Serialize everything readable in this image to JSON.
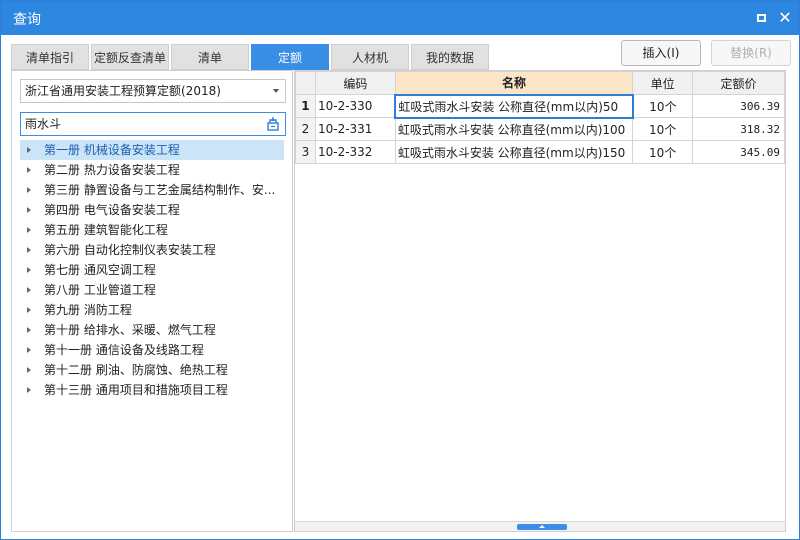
{
  "window": {
    "title": "查询"
  },
  "tabs": [
    {
      "label": "清单指引"
    },
    {
      "label": "定额反查清单"
    },
    {
      "label": "清单"
    },
    {
      "label": "定额"
    },
    {
      "label": "人材机"
    },
    {
      "label": "我的数据"
    }
  ],
  "toolbar": {
    "insert_label": "插入(I)",
    "replace_label": "替换(R)"
  },
  "left": {
    "selected_norm": "浙江省通用安装工程预算定额(2018)",
    "search_value": "雨水斗",
    "tree": [
      {
        "label": "第一册 机械设备安装工程"
      },
      {
        "label": "第二册 热力设备安装工程"
      },
      {
        "label": "第三册 静置设备与工艺金属结构制作、安..."
      },
      {
        "label": "第四册 电气设备安装工程"
      },
      {
        "label": "第五册 建筑智能化工程"
      },
      {
        "label": "第六册 自动化控制仪表安装工程"
      },
      {
        "label": "第七册 通风空调工程"
      },
      {
        "label": "第八册 工业管道工程"
      },
      {
        "label": "第九册 消防工程"
      },
      {
        "label": "第十册 给排水、采暖、燃气工程"
      },
      {
        "label": "第十一册 通信设备及线路工程"
      },
      {
        "label": "第十二册 刷油、防腐蚀、绝热工程"
      },
      {
        "label": "第十三册 通用项目和措施项目工程"
      }
    ]
  },
  "table": {
    "headers": {
      "code": "编码",
      "name": "名称",
      "unit": "单位",
      "price": "定额价"
    },
    "rows": [
      {
        "idx": "1",
        "code": "10-2-330",
        "name": "虹吸式雨水斗安装 公称直径(mm以内)50",
        "unit": "10个",
        "price": "306.39"
      },
      {
        "idx": "2",
        "code": "10-2-331",
        "name": "虹吸式雨水斗安装 公称直径(mm以内)100",
        "unit": "10个",
        "price": "318.32"
      },
      {
        "idx": "3",
        "code": "10-2-332",
        "name": "虹吸式雨水斗安装 公称直径(mm以内)150",
        "unit": "10个",
        "price": "345.09"
      }
    ]
  },
  "colors": {
    "titlebar": "#2d86e0",
    "active_tab": "#3a8ee6",
    "name_header": "#fde5c8",
    "selected_tree": "#cce4f7"
  }
}
